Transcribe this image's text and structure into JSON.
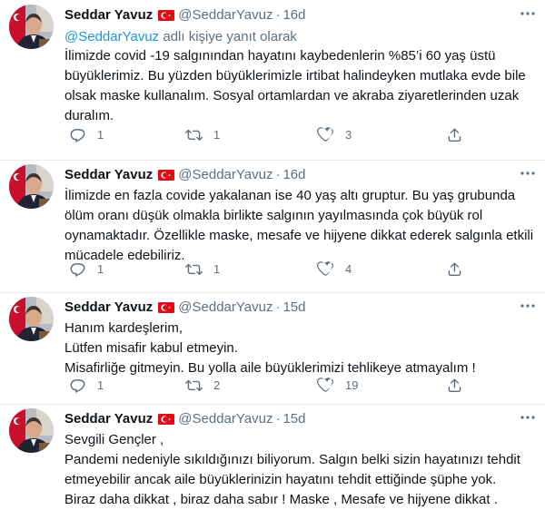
{
  "tweets": [
    {
      "name": "Seddar Yavuz",
      "handle": "@SeddarYavuz",
      "dot": "·",
      "time": "16d",
      "reply_prefix": "@SeddarYavuz",
      "reply_suffix": " adlı kişiye yanıt olarak",
      "lines": [
        "İlimizde covid -19 salgınından hayatını kaybedenlerin %85’i 60 yaş üstü",
        "büyüklerimiz. Bu yüzden büyüklerimizle irtibat halindeyken mutlaka evde bile",
        "olsak maske kullanalım. Sosyal ortamlardan ve akraba ziyaretlerinden uzak",
        "duralım."
      ],
      "replies": "1",
      "retweets": "1",
      "likes": "3"
    },
    {
      "name": "Seddar Yavuz",
      "handle": "@SeddarYavuz",
      "dot": "·",
      "time": "16d",
      "lines": [
        "İlimizde en fazla covide yakalanan ise 40 yaş altı gruptur. Bu yaş grubunda",
        "ölüm oranı düşük olmakla birlikte salgının yayılmasında çok büyük rol",
        "oynamaktadır. Özellikle maske, mesafe ve hijyene dikkat ederek salgınla etkili",
        "mücadele edebiliriz."
      ],
      "replies": "1",
      "retweets": "1",
      "likes": "4"
    },
    {
      "name": "Seddar Yavuz",
      "handle": "@SeddarYavuz",
      "dot": "·",
      "time": "15d",
      "lines": [
        "Hanım kardeşlerim,",
        "Lütfen misafir kabul etmeyin.",
        "Misafirliğe gitmeyin. Bu yolla aile büyüklerimizi tehlikeye atmayalım !"
      ],
      "replies": "1",
      "retweets": "2",
      "likes": "19"
    },
    {
      "name": "Seddar Yavuz",
      "handle": "@SeddarYavuz",
      "dot": "·",
      "time": "15d",
      "lines": [
        "Sevgili Gençler ,",
        "Pandemi nedeniyle sıkıldığınızı biliyorum. Salgın belki sizin hayatınızı tehdit",
        "etmeyebilir ancak aile büyüklerinizin hayatını tehdit ettiğinde şüphe yok.",
        "Biraz daha dikkat , biraz daha sabır ! Maske , Mesafe ve hijyene dikkat ."
      ]
    }
  ],
  "colors": {
    "text": "#0f1419",
    "muted": "#5b7083",
    "link": "#1b95e0",
    "flag_red": "#e30a17",
    "divider": "#e6ecf0"
  },
  "icons": {
    "flag": "turkey-flag-icon",
    "more": "more-options-icon",
    "reply": "reply-icon",
    "retweet": "retweet-icon",
    "like": "heart-icon",
    "share": "share-icon"
  }
}
